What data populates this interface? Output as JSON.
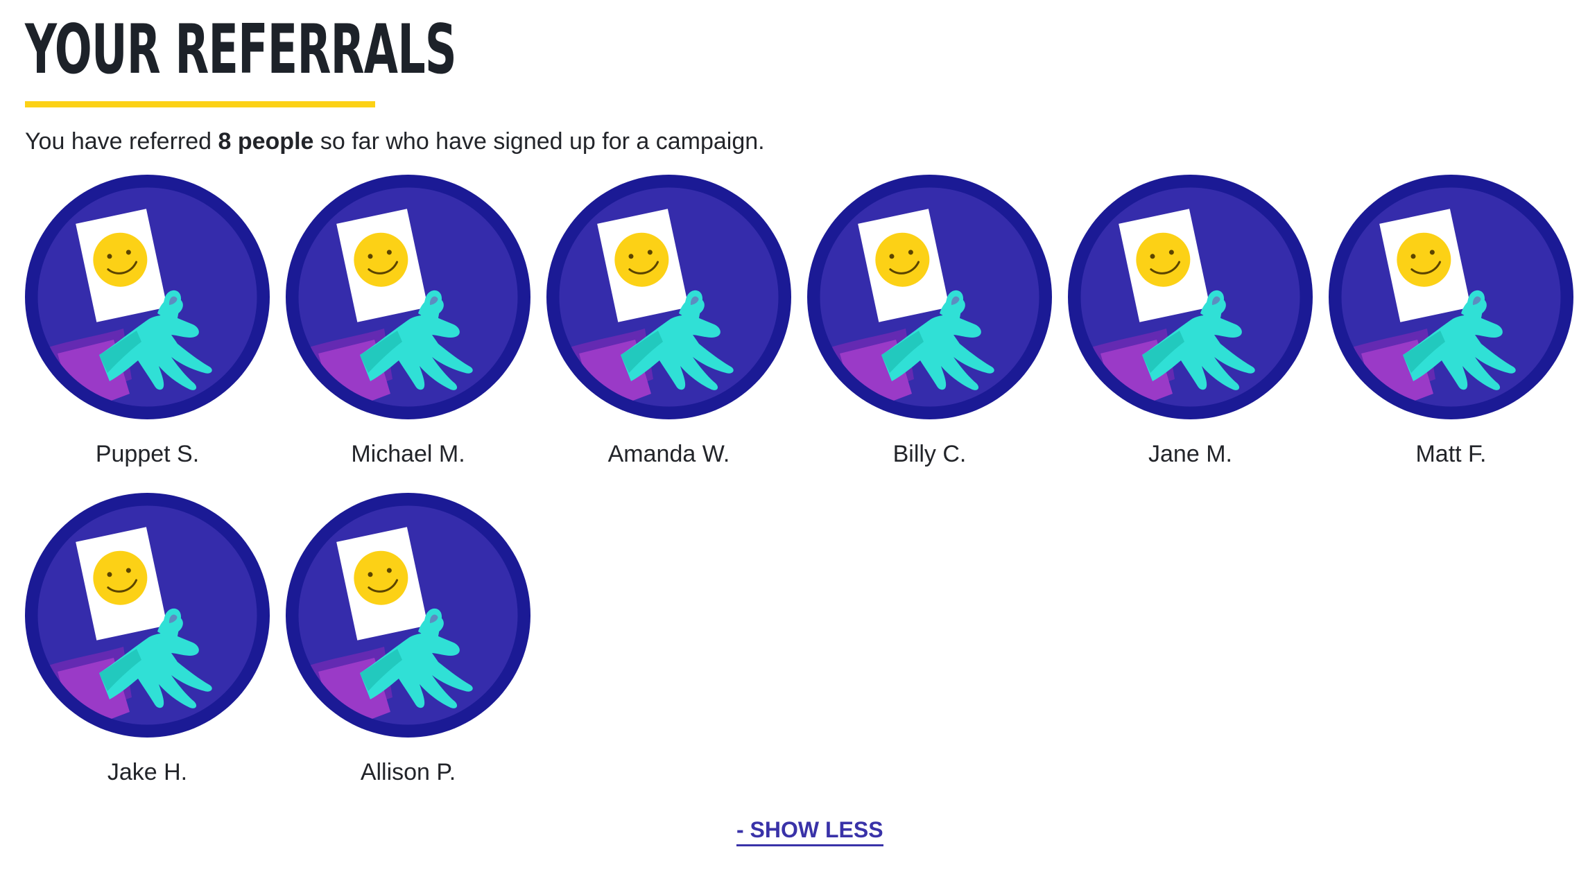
{
  "header": {
    "title": "YOUR REFERRALS"
  },
  "summary": {
    "prefix": "You have referred ",
    "count": "8 people",
    "suffix": " so far who have signed up for a campaign."
  },
  "referrals": [
    {
      "name": "Puppet S.",
      "icon": "smiley-sign-hand-icon"
    },
    {
      "name": "Michael M.",
      "icon": "smiley-sign-hand-icon"
    },
    {
      "name": "Amanda W.",
      "icon": "smiley-sign-hand-icon"
    },
    {
      "name": "Billy C.",
      "icon": "smiley-sign-hand-icon"
    },
    {
      "name": "Jane M.",
      "icon": "smiley-sign-hand-icon"
    },
    {
      "name": "Matt F.",
      "icon": "smiley-sign-hand-icon"
    },
    {
      "name": "Jake H.",
      "icon": "smiley-sign-hand-icon"
    },
    {
      "name": "Allison P.",
      "icon": "smiley-sign-hand-icon"
    }
  ],
  "actions": {
    "show_less_label": "- SHOW LESS"
  },
  "colors": {
    "accent_yellow": "#fcd116",
    "badge_ring": "#1b1a95",
    "badge_fill": "#352cab",
    "hand": "#30e0d6",
    "sleeve": "#9a3ac7",
    "link": "#3932a8"
  }
}
